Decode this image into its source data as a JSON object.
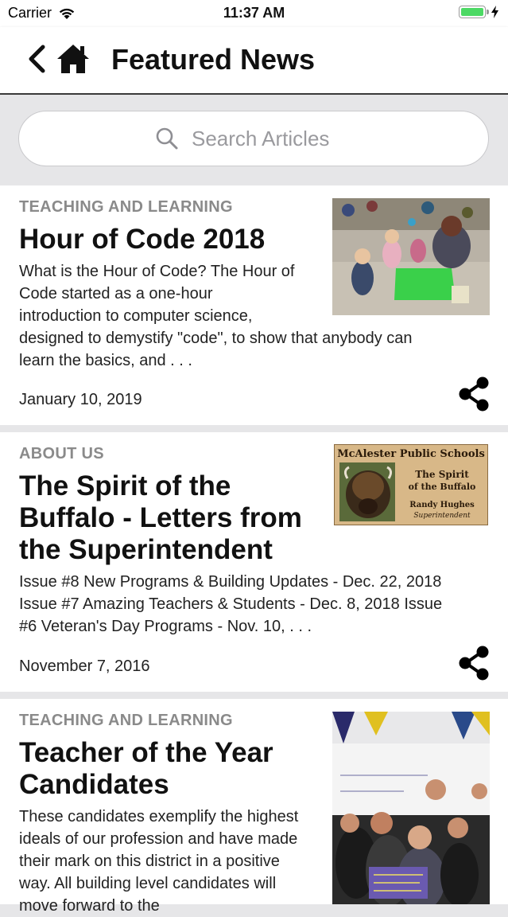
{
  "status": {
    "carrier": "Carrier",
    "time": "11:37 AM"
  },
  "nav": {
    "title": "Featured News"
  },
  "search": {
    "placeholder": "Search Articles"
  },
  "articles": [
    {
      "category": "TEACHING AND LEARNING",
      "title_lines": [
        "Hour of Code 2018"
      ],
      "summary_lines": [
        "What is the Hour of Code? The Hour of",
        "Code started as a one-hour",
        "introduction to computer science,",
        "designed to demystify \"code\", to show that anybody can",
        "learn the basics, and . . ."
      ],
      "date": "January 10, 2019"
    },
    {
      "category": "ABOUT US",
      "title_lines": [
        "The Spirit of the",
        "Buffalo - Letters from",
        "the Superintendent"
      ],
      "summary_lines": [
        "Issue #8 New Programs & Building Updates - Dec. 22, 2018",
        "Issue #7 Amazing Teachers & Students - Dec. 8, 2018 Issue",
        "#6 Veteran's Day Programs - Nov. 10, . . ."
      ],
      "date": "November 7, 2016",
      "image_text": {
        "school": "McAlester Public Schools",
        "line1": "The Spirit",
        "line2": "of the Buffalo",
        "name": "Randy Hughes",
        "role": "Superintendent"
      }
    },
    {
      "category": "TEACHING AND LEARNING",
      "title_lines": [
        "Teacher of the Year",
        "Candidates"
      ],
      "summary_lines": [
        "These candidates exemplify the highest",
        "ideals of our profession and have made",
        "their mark on this district in a positive",
        "way. All building level candidates will",
        "move forward to the"
      ],
      "date": ""
    }
  ],
  "colors": {
    "accent_battery": "#4cd964",
    "category_gray": "#8a8a8a",
    "background": "#e6e6e8"
  }
}
